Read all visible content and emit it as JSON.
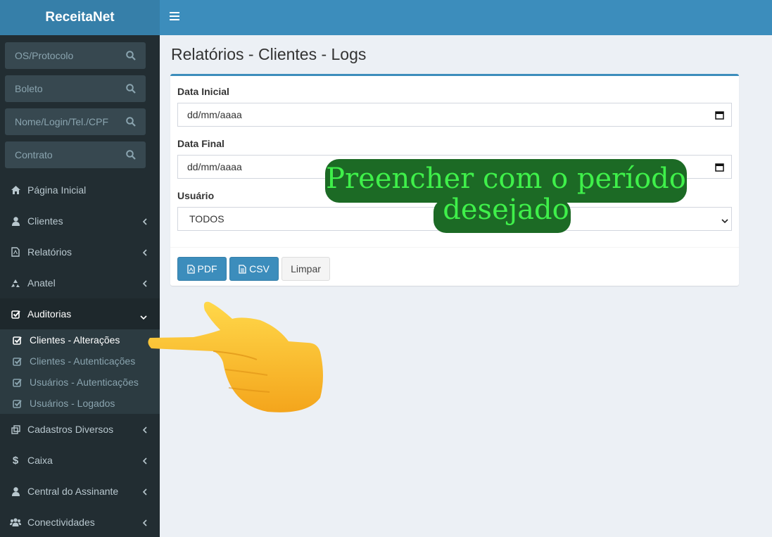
{
  "app": {
    "name": "ReceitaNet"
  },
  "sidebar": {
    "search": [
      {
        "placeholder": "OS/Protocolo"
      },
      {
        "placeholder": "Boleto"
      },
      {
        "placeholder": "Nome/Login/Tel./CPF"
      },
      {
        "placeholder": "Contrato"
      }
    ],
    "menu": [
      {
        "label": "Página Inicial",
        "icon": "home-icon"
      },
      {
        "label": "Clientes",
        "icon": "user-icon"
      },
      {
        "label": "Relatórios",
        "icon": "file-pdf-icon"
      },
      {
        "label": "Anatel",
        "icon": "recycle-icon"
      },
      {
        "label": "Auditorias",
        "icon": "check-square-icon"
      },
      {
        "label": "Cadastros Diversos",
        "icon": "clone-icon"
      },
      {
        "label": "Caixa",
        "icon": "dollar-icon"
      },
      {
        "label": "Central do Assinante",
        "icon": "user-icon"
      },
      {
        "label": "Conectividades",
        "icon": "users-icon"
      }
    ],
    "submenu": [
      {
        "label": "Clientes - Alterações"
      },
      {
        "label": "Clientes - Autenticações"
      },
      {
        "label": "Usuários - Autenticações"
      },
      {
        "label": "Usuários - Logados"
      }
    ]
  },
  "page": {
    "title": "Relatórios - Clientes - Logs",
    "form": {
      "start_label": "Data Inicial",
      "start_value": "dd/mm/aaaa",
      "end_label": "Data Final",
      "end_value": "dd/mm/aaaa",
      "user_label": "Usuário",
      "user_value": "TODOS"
    },
    "buttons": {
      "pdf": "PDF",
      "csv": "CSV",
      "clear": "Limpar"
    }
  },
  "annotation": {
    "line1": "Preencher com o período",
    "line2": "desejado",
    "text_color": "#3ff04a",
    "bg_color": "#1c6a25"
  },
  "colors": {
    "header": "#3c8dbc",
    "sidebar": "#222d32",
    "logo_bg": "#367fa9"
  }
}
